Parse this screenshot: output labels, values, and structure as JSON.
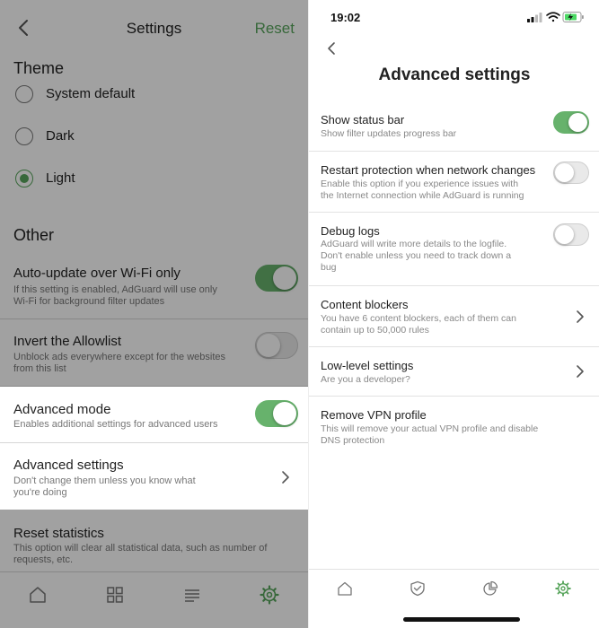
{
  "left": {
    "nav": {
      "title": "Settings",
      "reset_label": "Reset"
    },
    "theme": {
      "title": "Theme",
      "options": [
        {
          "label": "System default",
          "selected": false
        },
        {
          "label": "Dark",
          "selected": false
        },
        {
          "label": "Light",
          "selected": true
        }
      ]
    },
    "other": {
      "title": "Other",
      "rows": [
        {
          "title": "Auto-update over Wi-Fi only",
          "subtitle_1": "If this setting is enabled, AdGuard will use only",
          "subtitle_2": "Wi-Fi for background filter updates",
          "enabled": true
        },
        {
          "title": "Invert the Allowlist",
          "subtitle_1": "Unblock ads everywhere except for the websites",
          "subtitle_2": "from this list",
          "enabled": false
        },
        {
          "title": "Advanced mode",
          "subtitle_1": "Enables additional settings for advanced users",
          "enabled": true
        },
        {
          "title": "Advanced settings",
          "subtitle_1": "Don't change them unless you know what",
          "subtitle_2": "you're doing"
        },
        {
          "title": "Reset statistics",
          "subtitle_1": "This option will clear all statistical data, such as number of",
          "subtitle_2": "requests, etc."
        }
      ]
    },
    "tabbar": [
      "home-icon",
      "apps-grid-icon",
      "list-icon",
      "gear-icon"
    ]
  },
  "right": {
    "status": {
      "time": "19:02"
    },
    "nav": {
      "title": "Advanced settings"
    },
    "rows": [
      {
        "title": "Show status bar",
        "subtitle_1": "Show filter updates progress bar",
        "enabled": true
      },
      {
        "title": "Restart protection when network changes",
        "subtitle_1": "Enable this option if you experience issues with",
        "subtitle_2": "the Internet connection while AdGuard is running",
        "enabled": false
      },
      {
        "title": "Debug logs",
        "subtitle_1": "AdGuard will write more details to the logfile.",
        "subtitle_2": "Don't enable unless you need to track down a",
        "subtitle_3": "bug",
        "enabled": false
      },
      {
        "title": "Content blockers",
        "subtitle_1": "You have 6 content blockers, each of them can",
        "subtitle_2": "contain up to 50,000 rules"
      },
      {
        "title": "Low-level settings",
        "subtitle_1": "Are you a developer?"
      },
      {
        "title": "Remove VPN profile",
        "subtitle_1": "This will remove your actual VPN profile and disable",
        "subtitle_2": "DNS protection"
      }
    ],
    "tabbar": [
      "home-icon",
      "shield-check-icon",
      "pie-chart-icon",
      "gear-icon"
    ]
  },
  "colors": {
    "accent": "#58a55c",
    "toggle_on": "#67b26c",
    "dim_overlay": "rgba(0,0,0,0.37)"
  }
}
